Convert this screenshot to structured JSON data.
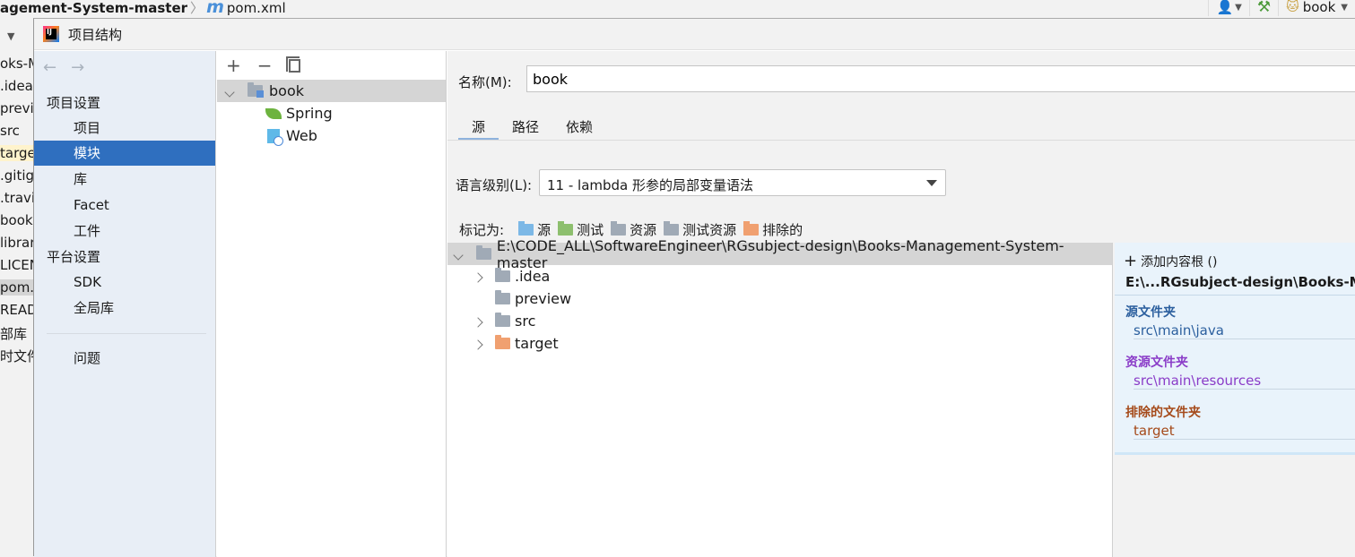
{
  "ide": {
    "breadcrumb_project": "agement-System-master",
    "breadcrumb_file": "pom.xml",
    "module_selector": "book",
    "tree_items": [
      "oks-M",
      ".idea",
      "previ",
      "src",
      "targe",
      ".gitig",
      ".travis",
      "book",
      "librar",
      "LICEN",
      "pom.",
      "READ",
      "部库",
      "时文件"
    ]
  },
  "dialog": {
    "title": "项目结构",
    "nav": {
      "project_settings_header": "项目设置",
      "project": "项目",
      "modules": "模块",
      "libraries": "库",
      "facets": "Facet",
      "artifacts": "工件",
      "platform_settings_header": "平台设置",
      "sdk": "SDK",
      "global_libraries": "全局库",
      "problems": "问题"
    },
    "modules_tree": {
      "root": "book",
      "children": [
        "Spring",
        "Web"
      ]
    },
    "details": {
      "name_label": "名称(M):",
      "name_value": "book",
      "tabs": [
        "源",
        "路径",
        "依赖"
      ],
      "language_level_label": "语言级别(L):",
      "language_level_value": "11 - lambda 形参的局部变量语法",
      "mark_as_label": "标记为:",
      "mark_as": [
        {
          "label": "源",
          "color": "#7cb8e6"
        },
        {
          "label": "测试",
          "color": "#8dbf6e"
        },
        {
          "label": "资源",
          "color": "#a0aab6"
        },
        {
          "label": "测试资源",
          "color": "#a0aab6"
        },
        {
          "label": "排除的",
          "color": "#f0a070"
        }
      ]
    },
    "content_root": {
      "path": "E:\\CODE_ALL\\SoftwareEngineer\\RGsubject-design\\Books-Management-System-master",
      "folders": [
        {
          "name": ".idea",
          "expandable": true,
          "color": "#a0aab6"
        },
        {
          "name": "preview",
          "expandable": false,
          "color": "#a0aab6"
        },
        {
          "name": "src",
          "expandable": true,
          "color": "#a0aab6"
        },
        {
          "name": "target",
          "expandable": true,
          "color": "#f0a070"
        }
      ]
    },
    "root_info": {
      "add_label": "添加内容根 ()",
      "path_short": "E:\\...RGsubject-design\\Books-Mana",
      "source_header": "源文件夹",
      "source_path": "src\\main\\java",
      "resource_header": "资源文件夹",
      "resource_path": "src\\main\\resources",
      "excluded_header": "排除的文件夹",
      "excluded_path": "target",
      "colors": {
        "source": "#2b5f9e",
        "resource": "#8a3cc8",
        "excluded": "#a54a1a"
      }
    }
  }
}
